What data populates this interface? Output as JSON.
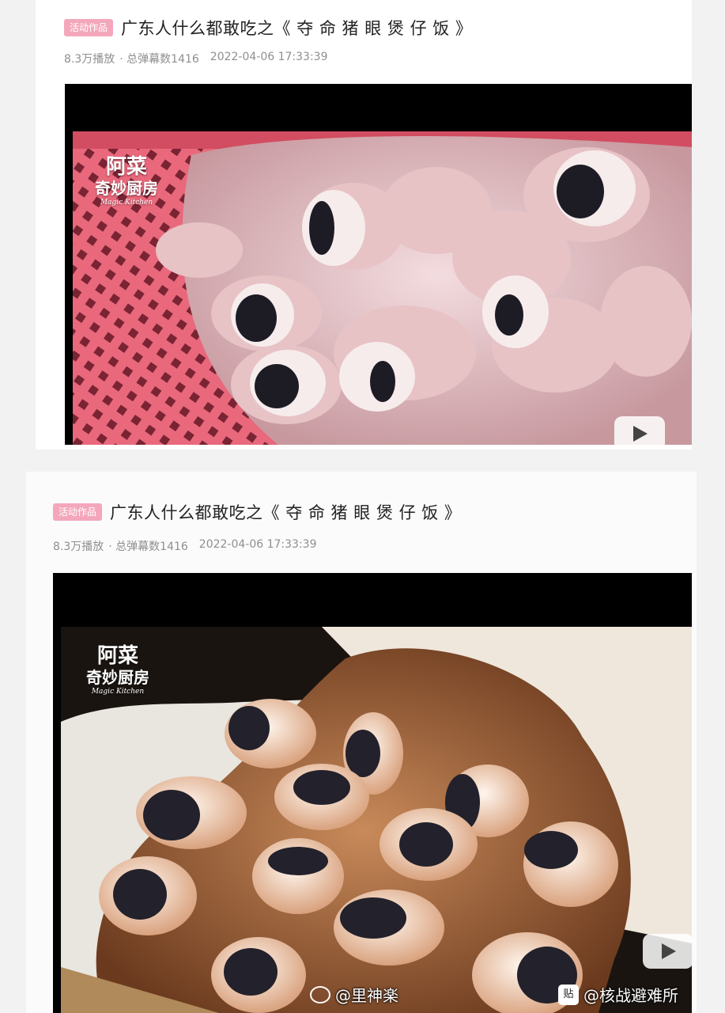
{
  "posts": [
    {
      "badge": "活动作品",
      "title": "广东人什么都敢吃之《 夺 命 猪 眼 煲 仔 饭 》",
      "plays": "8.3万播放",
      "danmaku": "· 总弹幕数1416",
      "date": "2022-04-06 17:33:39",
      "brand": {
        "line1": "阿菜",
        "line2": "奇妙厨房",
        "line3": "Magic Kitchen"
      }
    },
    {
      "badge": "活动作品",
      "title": "广东人什么都敢吃之《 夺 命 猪 眼 煲 仔 饭 》",
      "plays": "8.3万播放",
      "danmaku": "· 总弹幕数1416",
      "date": "2022-04-06 17:33:39",
      "brand": {
        "line1": "阿菜",
        "line2": "奇妙厨房",
        "line3": "Magic Kitchen"
      }
    }
  ],
  "watermarks": {
    "weibo": "@里神楽",
    "tieba_icon": "贴",
    "tieba": "@核战避难所"
  }
}
